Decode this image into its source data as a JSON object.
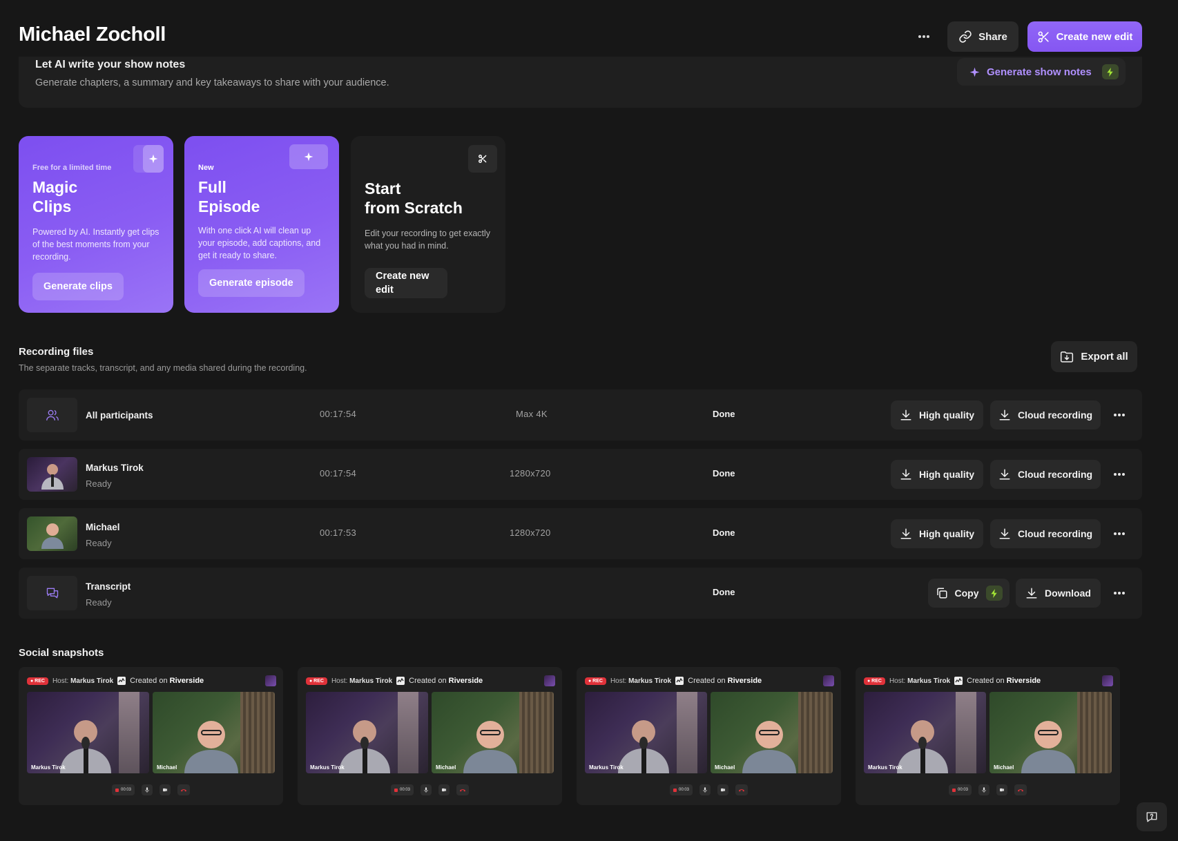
{
  "header": {
    "title": "Michael Zocholl",
    "share_label": "Share",
    "create_label": "Create new edit"
  },
  "notes_banner": {
    "title": "Let AI write your show notes",
    "subtitle": "Generate chapters, a summary and key takeaways to share with your audience.",
    "button_label": "Generate show notes"
  },
  "cards": {
    "magic": {
      "label": "Free for a limited time",
      "title_line1": "Magic",
      "title_line2": "Clips",
      "description": "Powered by AI. Instantly get clips of the best moments from your recording.",
      "button_label": "Generate clips"
    },
    "full": {
      "label": "New",
      "title_line1": "Full",
      "title_line2": "Episode",
      "description": "With one click AI will clean up your episode, add captions, and get it ready to share.",
      "button_label": "Generate episode"
    },
    "scratch": {
      "title_line1": "Start",
      "title_line2": "from Scratch",
      "description": "Edit your recording to get exactly what you had in mind.",
      "button_line1": "Create new",
      "button_line2": "edit"
    }
  },
  "recording_files": {
    "title": "Recording files",
    "subtitle": "The separate tracks, transcript, and any media shared during the recording.",
    "export_label": "Export all",
    "hq_label": "High quality",
    "cloud_label": "Cloud recording",
    "copy_label": "Copy",
    "download_label": "Download",
    "rows": [
      {
        "name": "All participants",
        "status": "",
        "duration": "00:17:54",
        "resolution": "Max 4K",
        "state": "Done"
      },
      {
        "name": "Markus Tirok",
        "status": "Ready",
        "duration": "00:17:54",
        "resolution": "1280x720",
        "state": "Done"
      },
      {
        "name": "Michael",
        "status": "Ready",
        "duration": "00:17:53",
        "resolution": "1280x720",
        "state": "Done"
      },
      {
        "name": "Transcript",
        "status": "Ready",
        "duration": "",
        "resolution": "",
        "state": "Done"
      }
    ]
  },
  "snapshots": {
    "title": "Social snapshots",
    "rec_label": "● REC",
    "host_prefix": "Host:",
    "host_name": "Markus Tirok",
    "created_prefix": "Created on",
    "created_brand": "Riverside",
    "left_name": "Markus Tirok",
    "right_name": "Michael",
    "timer": "00:03"
  },
  "colors": {
    "accent": "#8b5cf6",
    "background": "#171717",
    "bolt_green": "#a3e635"
  }
}
